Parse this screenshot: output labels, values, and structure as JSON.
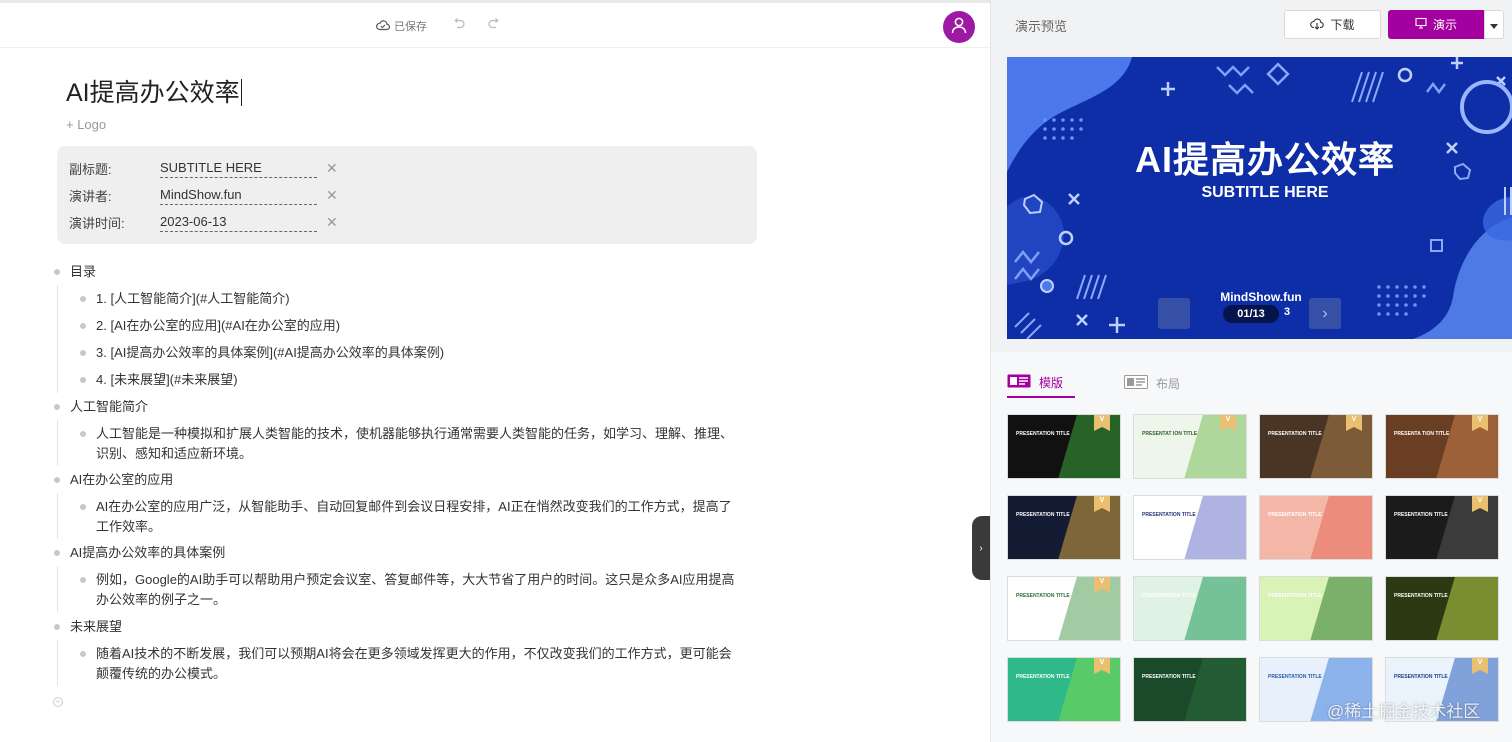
{
  "toolbar": {
    "save_status": "已保存",
    "undo_icon": "undo-icon",
    "redo_icon": "redo-icon",
    "avatar_icon": "user-icon"
  },
  "document": {
    "title": "AI提高办公效率",
    "add_logo": "+ Logo",
    "meta": [
      {
        "label": "副标题:",
        "value": "SUBTITLE HERE"
      },
      {
        "label": "演讲者:",
        "value": "MindShow.fun"
      },
      {
        "label": "演讲时间:",
        "value": "2023-06-13"
      }
    ],
    "outline": [
      {
        "text": "目录",
        "children": [
          "1. [人工智能简介](#人工智能简介)",
          "2. [AI在办公室的应用](#AI在办公室的应用)",
          "3. [AI提高办公效率的具体案例](#AI提高办公效率的具体案例)",
          "4. [未来展望](#未来展望)"
        ]
      },
      {
        "text": "人工智能简介",
        "children": [
          "人工智能是一种模拟和扩展人类智能的技术，使机器能够执行通常需要人类智能的任务，如学习、理解、推理、识别、感知和适应新环境。"
        ]
      },
      {
        "text": "AI在办公室的应用",
        "children": [
          "AI在办公室的应用广泛，从智能助手、自动回复邮件到会议日程安排，AI正在悄然改变我们的工作方式，提高了工作效率。"
        ]
      },
      {
        "text": "AI提高办公效率的具体案例",
        "children": [
          "例如，Google的AI助手可以帮助用户预定会议室、答复邮件等，大大节省了用户的时间。这只是众多AI应用提高办公效率的例子之一。"
        ]
      },
      {
        "text": "未来展望",
        "children": [
          "随着AI技术的不断发展，我们可以预期AI将会在更多领域发挥更大的作用，不仅改变我们的工作方式，更可能会颠覆传统的办公模式。"
        ]
      }
    ]
  },
  "panel": {
    "preview_title": "演示预览",
    "download_label": "下载",
    "present_label": "演示",
    "slide": {
      "title": "AI提高办公效率",
      "subtitle": "SUBTITLE HERE",
      "presenter": "MindShow.fun",
      "counter": "01/13",
      "date_partial": "3"
    },
    "tabs": {
      "template": "模版",
      "layout": "布局"
    },
    "templates": [
      {
        "title": "PRESENTATION TITLE",
        "bg": "#111111",
        "fg": "#ffffff",
        "accent": "#3aa83a",
        "vip": true
      },
      {
        "title": "PRESENTAT ION TITLE",
        "bg": "#eef5ea",
        "fg": "#2f5f2f",
        "accent": "#7bbd5a",
        "vip": true
      },
      {
        "title": "PRESENTATION TITLE",
        "bg": "#4a3525",
        "fg": "#ffffff",
        "accent": "#a77a4a",
        "vip": true
      },
      {
        "title": "PRESENTA TION TITLE",
        "bg": "#6a3e22",
        "fg": "#ffffff",
        "accent": "#c77c4a",
        "vip": true
      },
      {
        "title": "PRESENTATION TITLE",
        "bg": "#141c33",
        "fg": "#ffffff",
        "accent": "#d4a43a",
        "vip": true
      },
      {
        "title": "PRESENTATION TITLE",
        "bg": "#ffffff",
        "fg": "#223377",
        "accent": "#6b74c9",
        "vip": false
      },
      {
        "title": "PRESENTATION TITLE",
        "bg": "#f4b6a6",
        "fg": "#ffffff",
        "accent": "#e46a5a",
        "vip": false
      },
      {
        "title": "PRESENTATION TITLE",
        "bg": "#1b1b1b",
        "fg": "#ffffff",
        "accent": "#555555",
        "vip": true
      },
      {
        "title": "PRESENTATION TITLE",
        "bg": "#ffffff",
        "fg": "#2e6b3a",
        "accent": "#55a05a",
        "vip": true
      },
      {
        "title": "PRESENTATION TITLE",
        "bg": "#dff2e4",
        "fg": "#ffffff",
        "accent": "#1f9a5a",
        "vip": false
      },
      {
        "title": "PRESENTATION TITLE",
        "bg": "#d9f2b5",
        "fg": "#ffffff",
        "accent": "#2b7a2b",
        "vip": false
      },
      {
        "title": "PRESENTATION TITLE",
        "bg": "#2b3a12",
        "fg": "#ffffff",
        "accent": "#bcd14a",
        "vip": false
      },
      {
        "title": "PRESENTATION TITLE",
        "bg": "#2fb889",
        "fg": "#ffffff",
        "accent": "#7ad84a",
        "vip": true
      },
      {
        "title": "PRESENTATION TITLE",
        "bg": "#1a4a2a",
        "fg": "#ffffff",
        "accent": "#2b6b3a",
        "vip": false
      },
      {
        "title": "PRESENTATION TITLE",
        "bg": "#e8f1fb",
        "fg": "#2a5aa8",
        "accent": "#3f7ee0",
        "vip": false
      },
      {
        "title": "PRESENTATION TITLE",
        "bg": "#eaf2fb",
        "fg": "#1a3f88",
        "accent": "#2a5fc0",
        "vip": true
      }
    ],
    "watermark": "@稀土掘金技术社区"
  },
  "colors": {
    "brand": "#a3009f",
    "slide_bg": "#0d2ea6"
  }
}
